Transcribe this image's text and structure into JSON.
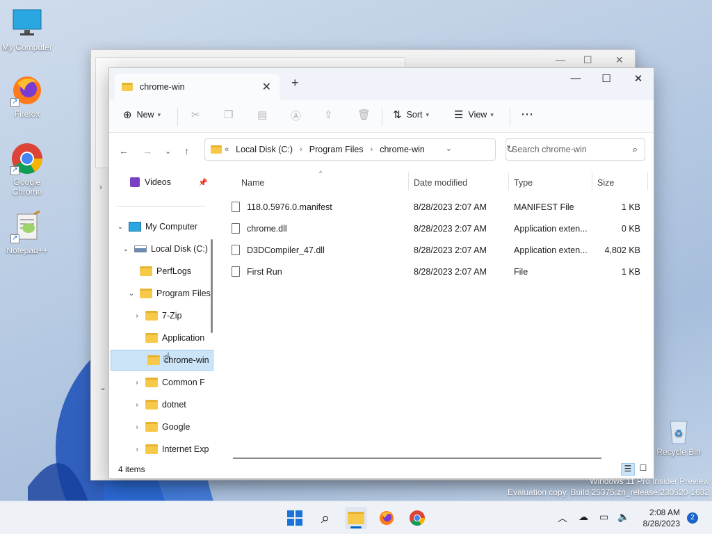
{
  "desktop": {
    "icons": [
      {
        "label": "My Computer"
      },
      {
        "label": "Firefox"
      },
      {
        "label": "Google Chrome"
      },
      {
        "label": "Notepad++"
      },
      {
        "label": "Recycle Bin"
      }
    ]
  },
  "window": {
    "tab_title": "chrome-win",
    "toolbar": {
      "new_label": "New",
      "sort_label": "Sort",
      "view_label": "View"
    },
    "address": {
      "crumbs": [
        "Local Disk (C:)",
        "Program Files",
        "chrome-win"
      ],
      "overflow": "«"
    },
    "search": {
      "placeholder": "Search chrome-win"
    },
    "nav": {
      "quick_item": "Videos",
      "tree": [
        {
          "label": "My Computer"
        },
        {
          "label": "Local Disk (C:)"
        },
        {
          "label": "PerfLogs"
        },
        {
          "label": "Program Files"
        },
        {
          "label": "7-Zip"
        },
        {
          "label": "Application"
        },
        {
          "label": "chrome-win"
        },
        {
          "label": "Common F"
        },
        {
          "label": "dotnet"
        },
        {
          "label": "Google"
        },
        {
          "label": "Internet Exp"
        }
      ]
    },
    "columns": [
      "Name",
      "Date modified",
      "Type",
      "Size"
    ],
    "files": [
      {
        "name": "118.0.5976.0.manifest",
        "date": "8/28/2023 2:07 AM",
        "type": "MANIFEST File",
        "size": "1 KB"
      },
      {
        "name": "chrome.dll",
        "date": "8/28/2023 2:07 AM",
        "type": "Application exten...",
        "size": "0 KB"
      },
      {
        "name": "D3DCompiler_47.dll",
        "date": "8/28/2023 2:07 AM",
        "type": "Application exten...",
        "size": "4,802 KB"
      },
      {
        "name": "First Run",
        "date": "8/28/2023 2:07 AM",
        "type": "File",
        "size": "1 KB"
      }
    ],
    "status": "4 items"
  },
  "watermark": {
    "line1": "Windows 11 Pro Insider Preview",
    "line2": "Evaluation copy. Build 25375.zn_release.230520-1632"
  },
  "taskbar": {
    "time": "2:08 AM",
    "date": "8/28/2023",
    "notifications": "2"
  },
  "colors": {
    "accent": "#0067c0",
    "folder": "#f7c948",
    "selection": "#cce4f7"
  }
}
